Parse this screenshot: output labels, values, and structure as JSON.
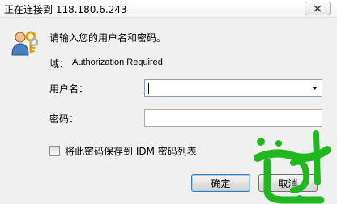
{
  "dialog": {
    "title": "正在连接到 118.180.6.243",
    "close_icon": "close-icon",
    "prompt": "请输入您的用户名和密码。",
    "realm_label": "域：",
    "realm_value": "Authorization Required",
    "username_label": "用户名：",
    "username_value": "",
    "password_label": "密码：",
    "password_value": "",
    "remember_label": "将此密码保存到 IDM 密码列表",
    "remember_checked": false,
    "ok_label": "确定",
    "cancel_label": "取消"
  },
  "watermark": {
    "text": "الترى",
    "color": "#1fb81f"
  }
}
